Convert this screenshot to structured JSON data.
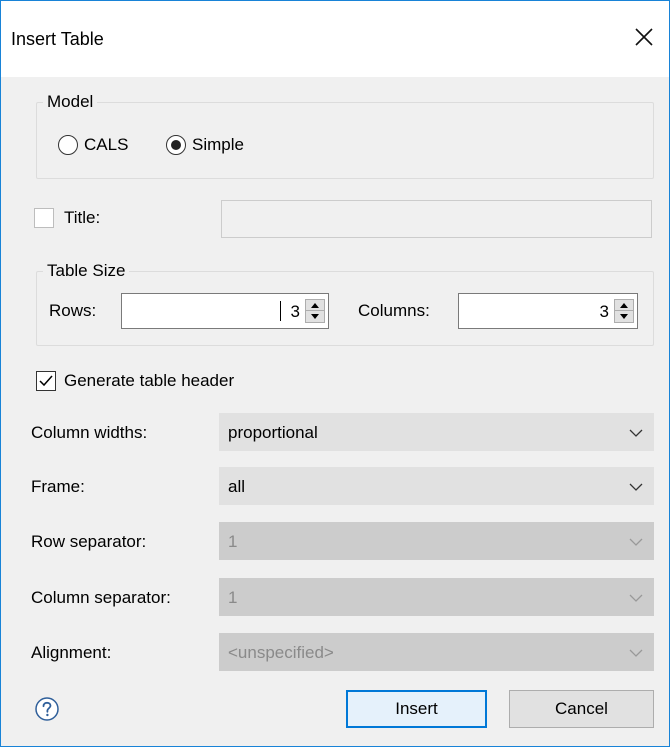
{
  "dialog": {
    "title": "Insert Table",
    "close_icon": "close-icon"
  },
  "model": {
    "legend": "Model",
    "options": [
      {
        "label": "CALS",
        "selected": false
      },
      {
        "label": "Simple",
        "selected": true
      }
    ]
  },
  "title_field": {
    "checked": false,
    "label": "Title:",
    "value": ""
  },
  "table_size": {
    "legend": "Table Size",
    "rows_label": "Rows:",
    "rows_value": "3",
    "columns_label": "Columns:",
    "columns_value": "3"
  },
  "generate_header": {
    "checked": true,
    "label": "Generate table header"
  },
  "column_widths": {
    "label": "Column widths:",
    "value": "proportional",
    "enabled": true
  },
  "frame": {
    "label": "Frame:",
    "value": "all",
    "enabled": true
  },
  "row_separator": {
    "label": "Row separator:",
    "value": "1",
    "enabled": false
  },
  "column_separator": {
    "label": "Column separator:",
    "value": "1",
    "enabled": false
  },
  "alignment": {
    "label": "Alignment:",
    "value": "<unspecified>",
    "enabled": false
  },
  "footer": {
    "help_icon": "help-icon",
    "insert_label": "Insert",
    "cancel_label": "Cancel"
  },
  "colors": {
    "accent": "#0078d7",
    "window_border": "#1883d7",
    "dialog_bg": "#f0f0f0"
  }
}
